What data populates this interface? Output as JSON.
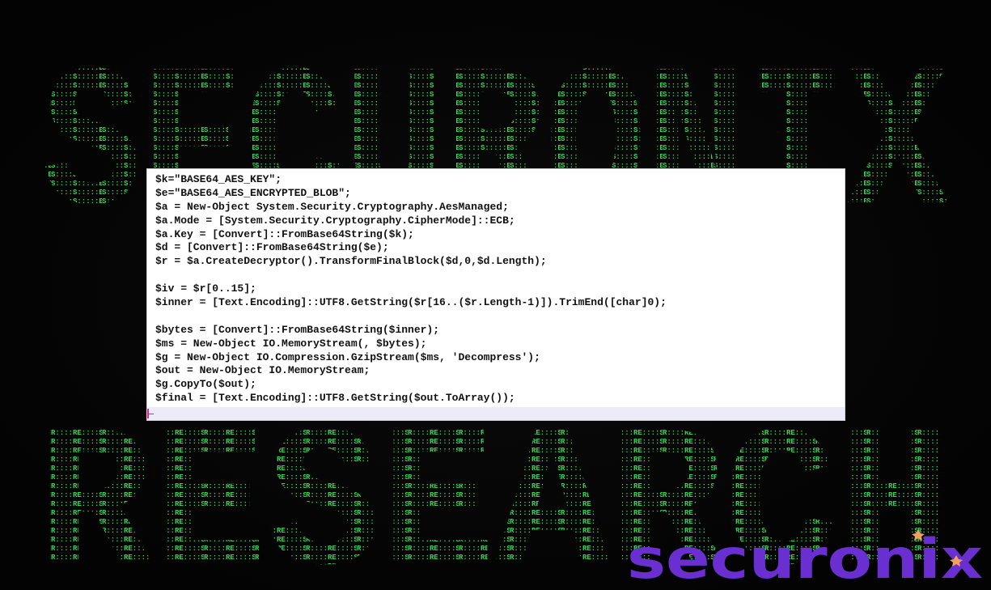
{
  "background": {
    "title_top": "SECURONIX",
    "title_bottom": "RESEARCH",
    "ascii_color": "#2fd24a"
  },
  "code": {
    "lines": [
      "$k=\"BASE64_AES_KEY\";",
      "$e=\"BASE64_AES_ENCRYPTED_BLOB\";",
      "$a = New-Object System.Security.Cryptography.AesManaged;",
      "$a.Mode = [System.Security.Cryptography.CipherMode]::ECB;",
      "$a.Key = [Convert]::FromBase64String($k);",
      "$d = [Convert]::FromBase64String($e);",
      "$r = $a.CreateDecryptor().TransformFinalBlock($d,0,$d.Length);",
      "",
      "$iv = $r[0..15];",
      "$inner = [Text.Encoding]::UTF8.GetString($r[16..($r.Length-1)]).TrimEnd([char]0);",
      "",
      "$bytes = [Convert]::FromBase64String($inner);",
      "$ms = New-Object IO.MemoryStream(, $bytes);",
      "$g = New-Object IO.Compression.GzipStream($ms, 'Decompress');",
      "$out = New-Object IO.MemoryStream;",
      "$g.CopyTo($out);",
      "$final = [Text.Encoding]::UTF8.GetString($out.ToArray());"
    ]
  },
  "brand": {
    "name": "securonix",
    "color": "#6a2fd0",
    "accent": "#f0a060"
  }
}
